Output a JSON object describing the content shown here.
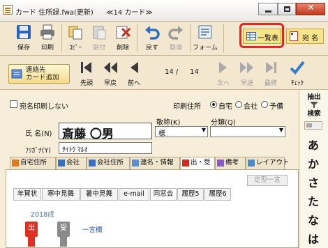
{
  "window": {
    "title": "カード 住所録.fwa(更新)",
    "subtitle": "≪14 カード≫"
  },
  "toolbar": {
    "save": "保存",
    "print": "印刷",
    "copy": "ｺﾋﾟｰ",
    "paste": "貼付",
    "delete": "削除",
    "undo": "戻す",
    "cancel": "取消",
    "form": "フォーム",
    "list": "一覧表",
    "address": "宛 名"
  },
  "nav": {
    "add_contact_line1": "連絡先",
    "add_contact_line2": "カード追加",
    "first": "先頭",
    "fast_back": "早戻",
    "prev": "前へ",
    "position": "14 /",
    "total": "14",
    "next": "次へ",
    "fast_fwd": "早送",
    "last": "最終",
    "check": "ﾁｪｯｸ"
  },
  "sidebar": {
    "extract_1": "抽出",
    "search": "検索",
    "kana": [
      "あ",
      "か",
      "さ",
      "た",
      "な",
      "は"
    ]
  },
  "form": {
    "no_print_label": "宛名印刷しない",
    "print_addr_label": "印刷住所",
    "radio_home": "自宅",
    "radio_company": "会社",
    "radio_spare": "予備",
    "honorific_label": "敬称(K)",
    "honorific_value": "様",
    "category_label": "分類(Q)",
    "category_value": "",
    "name_label": "氏 名(N)",
    "name_value": "斎藤 〇男",
    "furigana_label": "ﾌﾘｶﾞﾅ(Y)",
    "furigana_value": "ｻｲﾄｳ ﾏﾙｵ"
  },
  "tabs": [
    "自宅住所",
    "会社",
    "会社住所",
    "連名・情報",
    "出・受",
    "備考",
    "レイアウト"
  ],
  "subtabs": [
    "年賀状",
    "寒中見舞",
    "暑中見舞",
    "e-mail",
    "同窓会",
    "履歴5",
    "履歴6"
  ],
  "panel": {
    "template_button": "定型一言",
    "year": "2018戌",
    "out_label": "出",
    "in_label": "受",
    "message_label": "一言欄"
  },
  "colors": {
    "accent_red": "#e0281c",
    "nav_blue": "#2a7fd4",
    "toolbar_bg": "#f3e7cf"
  }
}
